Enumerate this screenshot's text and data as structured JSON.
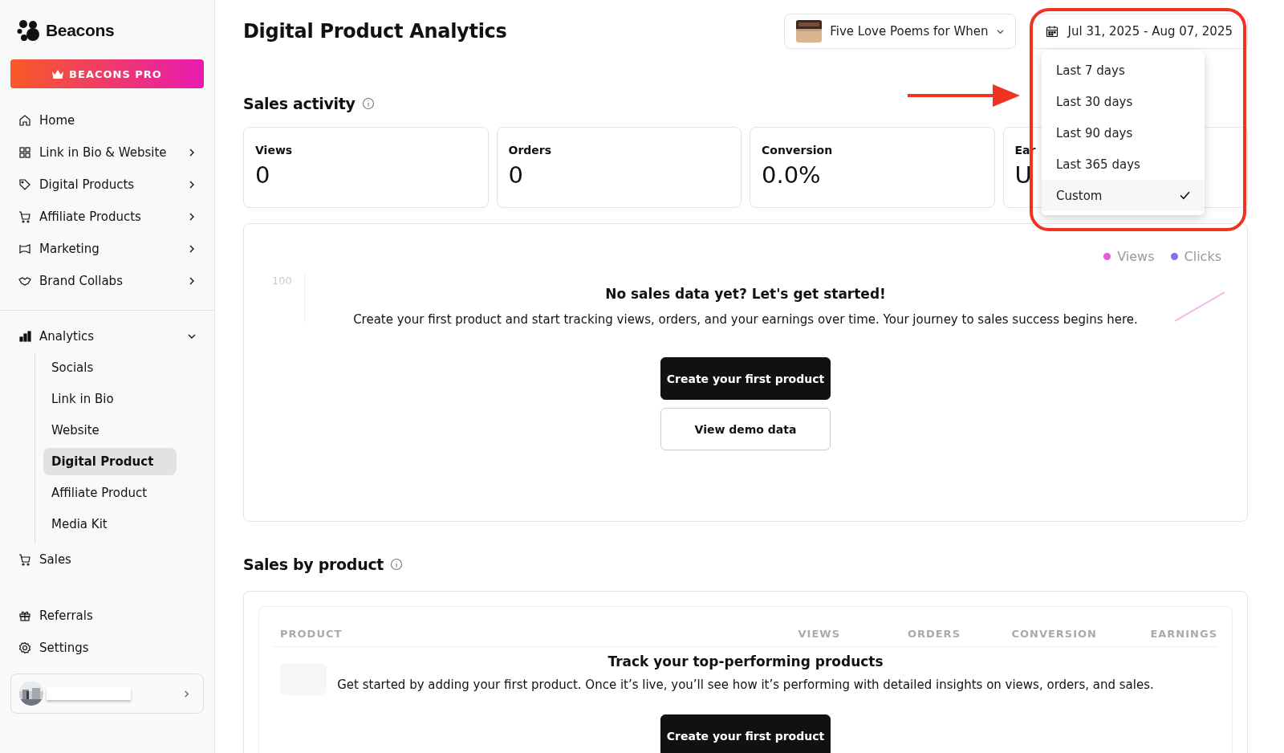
{
  "sidebar": {
    "brand": "Beacons",
    "pro_button": "BEACONS PRO",
    "nav": [
      {
        "label": "Home",
        "chevron": false
      },
      {
        "label": "Link in Bio & Website",
        "chevron": true
      },
      {
        "label": "Digital Products",
        "chevron": true
      },
      {
        "label": "Affiliate Products",
        "chevron": true
      },
      {
        "label": "Marketing",
        "chevron": true
      },
      {
        "label": "Brand Collabs",
        "chevron": true
      }
    ],
    "analytics": {
      "label": "Analytics",
      "expanded": true,
      "children": [
        {
          "label": "Socials",
          "selected": false
        },
        {
          "label": "Link in Bio",
          "selected": false
        },
        {
          "label": "Website",
          "selected": false
        },
        {
          "label": "Digital Product",
          "selected": true
        },
        {
          "label": "Affiliate Product",
          "selected": false
        },
        {
          "label": "Media Kit",
          "selected": false
        }
      ]
    },
    "sales": {
      "label": "Sales"
    },
    "bottom_nav": [
      {
        "label": "Referrals"
      },
      {
        "label": "Settings"
      }
    ]
  },
  "page": {
    "title": "Digital Product Analytics",
    "product_select": "Five Love Poems for When",
    "date_range": "Jul 31, 2025 - Aug 07, 2025",
    "date_menu": [
      {
        "label": "Last 7 days",
        "selected": false
      },
      {
        "label": "Last 30 days",
        "selected": false
      },
      {
        "label": "Last 90 days",
        "selected": false
      },
      {
        "label": "Last 365 days",
        "selected": false
      },
      {
        "label": "Custom",
        "selected": true
      }
    ]
  },
  "sales_activity": {
    "heading": "Sales activity",
    "cards": [
      {
        "label": "Views",
        "value": "0"
      },
      {
        "label": "Orders",
        "value": "0"
      },
      {
        "label": "Conversion",
        "value": "0.0%"
      },
      {
        "label": "Ear",
        "value": "U"
      }
    ],
    "legend": [
      {
        "label": "Views",
        "color": "#e85ad8"
      },
      {
        "label": "Clicks",
        "color": "#8b6cf0"
      }
    ],
    "axis_label": "100",
    "empty_title": "No sales data yet? Let's get started!",
    "empty_text": "Create your first product and start tracking views, orders, and your earnings over time. Your journey to sales success begins here.",
    "primary_button": "Create your first product",
    "secondary_button": "View demo data"
  },
  "sales_by_product": {
    "heading": "Sales by product",
    "columns": [
      "PRODUCT",
      "VIEWS",
      "ORDERS",
      "CONVERSION",
      "EARNINGS"
    ],
    "empty_title": "Track your top-performing products",
    "empty_text": "Get started by adding your first product. Once it’s live, you’ll see how it’s performing with detailed insights on views, orders, and sales.",
    "primary_button": "Create your first product"
  }
}
